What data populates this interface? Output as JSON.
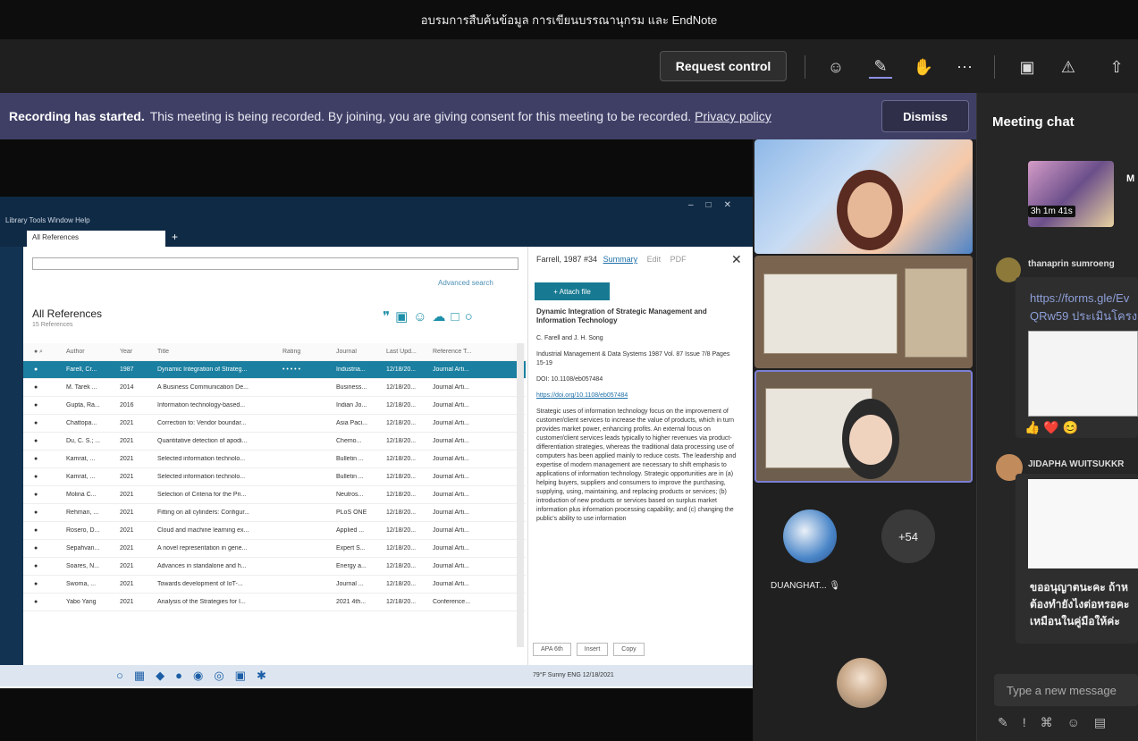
{
  "meeting": {
    "title": "อบรมการสืบค้นข้อมูล การเขียนบรรณานุกรม และ EndNote",
    "request_control": "Request control",
    "toolbar_icons": [
      "people-icon",
      "chat-icon",
      "reactions-icon",
      "more-icon",
      "camera-off-icon",
      "mic-off-icon",
      "share-icon"
    ]
  },
  "banner": {
    "bold": "Recording has started.",
    "text": "This meeting is being recorded. By joining, you are giving consent for this meeting to be recorded.",
    "privacy": "Privacy policy",
    "dismiss": "Dismiss"
  },
  "endnote": {
    "menu": "Library  Tools  Window  Help",
    "tab": "All References",
    "advanced_search": "Advanced search",
    "group_title": "All References",
    "group_count": "15 References",
    "columns": [
      "Author",
      "Year",
      "Title",
      "Rating",
      "Journal",
      "Last Upd...",
      "Reference T..."
    ],
    "rows": [
      [
        "Farell, Cr...",
        "1987",
        "Dynamic Integration of Strateg...",
        "• • • • •",
        "Industria...",
        "12/18/20...",
        "Journal Arti..."
      ],
      [
        "M. Tarek ...",
        "2014",
        "A Business Communication De...",
        "",
        "Business...",
        "12/18/20...",
        "Journal Arti..."
      ],
      [
        "Gupta, Ra...",
        "2016",
        "Information technology-based...",
        "",
        "Indian Jo...",
        "12/18/20...",
        "Journal Arti..."
      ],
      [
        "Chattopa...",
        "2021",
        "Correction to: Vendor boundar...",
        "",
        "Asia Paci...",
        "12/18/20...",
        "Journal Arti..."
      ],
      [
        "Du, C. S.; ...",
        "2021",
        "Quantitative detection of apodi...",
        "",
        "Chemo...",
        "12/18/20...",
        "Journal Arti..."
      ],
      [
        "Kamrat, ...",
        "2021",
        "Selected information technolo...",
        "",
        "Bulletin ...",
        "12/18/20...",
        "Journal Arti..."
      ],
      [
        "Kamrat, ...",
        "2021",
        "Selected information technolo...",
        "",
        "Bulletin ...",
        "12/18/20...",
        "Journal Arti..."
      ],
      [
        "Molina C...",
        "2021",
        "Selection of Criteria for the Pri...",
        "",
        "Neutros...",
        "12/18/20...",
        "Journal Arti..."
      ],
      [
        "Rehman, ...",
        "2021",
        "Fitting on all cylinders: Configur...",
        "",
        "PLoS ONE",
        "12/18/20...",
        "Journal Arti..."
      ],
      [
        "Rosero, D...",
        "2021",
        "Cloud and machine learning ex...",
        "",
        "Applied ...",
        "12/18/20...",
        "Journal Arti..."
      ],
      [
        "Sepahvan...",
        "2021",
        "A novel representation in gene...",
        "",
        "Expert S...",
        "12/18/20...",
        "Journal Arti..."
      ],
      [
        "Soares, N...",
        "2021",
        "Advances in standalone and h...",
        "",
        "Energy a...",
        "12/18/20...",
        "Journal Arti..."
      ],
      [
        "Swoma, ...",
        "2021",
        "Towards development of IoT-...",
        "",
        "Journal ...",
        "12/18/20...",
        "Journal Arti..."
      ],
      [
        "Yabo Yang",
        "2021",
        "Analysis of the Strategies for I...",
        "",
        "2021 4th...",
        "12/18/20...",
        "Conference..."
      ]
    ],
    "detail": {
      "header": "Farrell, 1987 #34",
      "tab_summary": "Summary",
      "tab_edit": "Edit",
      "tab_pdf": "PDF",
      "attach": "+ Attach file",
      "title": "Dynamic Integration of Strategic Management and Information Technology",
      "authors": "C. Farell and J. H. Song",
      "source": "Industrial Management & Data Systems 1987 Vol. 87 Issue 7/8 Pages 15-19",
      "doi": "DOI: 10.1108/eb057484",
      "link": "https://doi.org/10.1108/eb057484",
      "abstract": "Strategic uses of information technology focus on the improvement of customer/client services to increase the value of products, which in turn provides market power, enhancing profits. An external focus on customer/client services leads typically to higher revenues via product-differentiation strategies, whereas the traditional data processing use of computers has been applied mainly to reduce costs. The leadership and expertise of modern management are necessary to shift emphasis to applications of information technology. Strategic opportunities are in (a) helping buyers, suppliers and consumers to improve the purchasing, supplying, using, maintaining, and replacing products or services; (b) introduction of new products or services based on surplus market information plus information processing capability; and (c) changing the public's ability to use information",
      "style": "APA 6th",
      "insert": "Insert",
      "copy": "Copy"
    },
    "taskbar_tray": "79°F Sunny   ENG  12/18/2021"
  },
  "participants": {
    "name1": "DUANGHAT...",
    "more": "+54"
  },
  "chat": {
    "title": "Meeting chat",
    "recording_time": "3h 1m 41s",
    "rec_initial": "M",
    "sender1": "thanaprin sumroeng",
    "link1": "https://forms.gle/Ev QRw59 ประเมินโครง",
    "sender2": "JIDAPHA WUITSUKKR",
    "msg2": "ขออนุญาตนะคะ ถ้าห ต้องทำยังไงต่อหรอคะ เหมือนในคู่มือให้ค่ะ",
    "input_placeholder": "Type a new message"
  }
}
